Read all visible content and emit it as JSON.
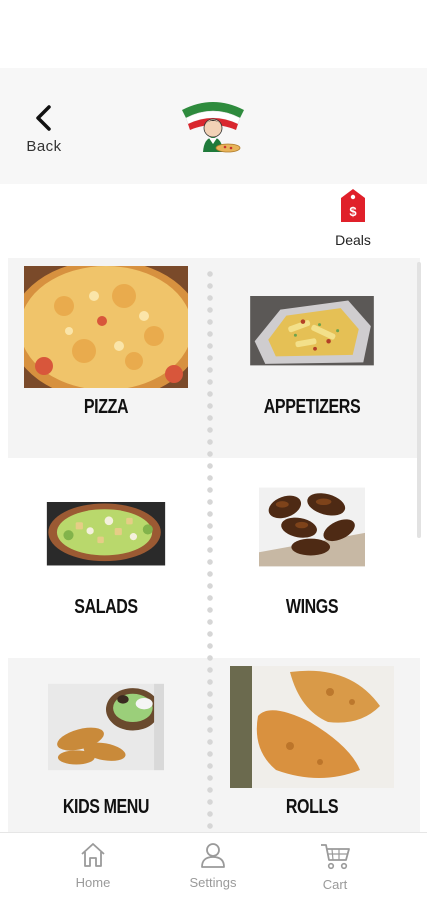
{
  "header": {
    "back_label": "Back",
    "logo_icon": "restaurant-logo"
  },
  "deals": {
    "label": "Deals",
    "icon": "price-tag-icon",
    "icon_symbol": "$",
    "color": "#e0202a"
  },
  "menu": {
    "categories": [
      {
        "label": "PIZZA"
      },
      {
        "label": "APPETIZERS"
      },
      {
        "label": "SALADS"
      },
      {
        "label": "WINGS"
      },
      {
        "label": "KIDS MENU"
      },
      {
        "label": "ROLLS"
      }
    ]
  },
  "tabbar": {
    "items": [
      {
        "label": "Home",
        "icon": "home-icon"
      },
      {
        "label": "Settings",
        "icon": "user-icon"
      },
      {
        "label": "Cart",
        "icon": "cart-icon"
      }
    ]
  }
}
